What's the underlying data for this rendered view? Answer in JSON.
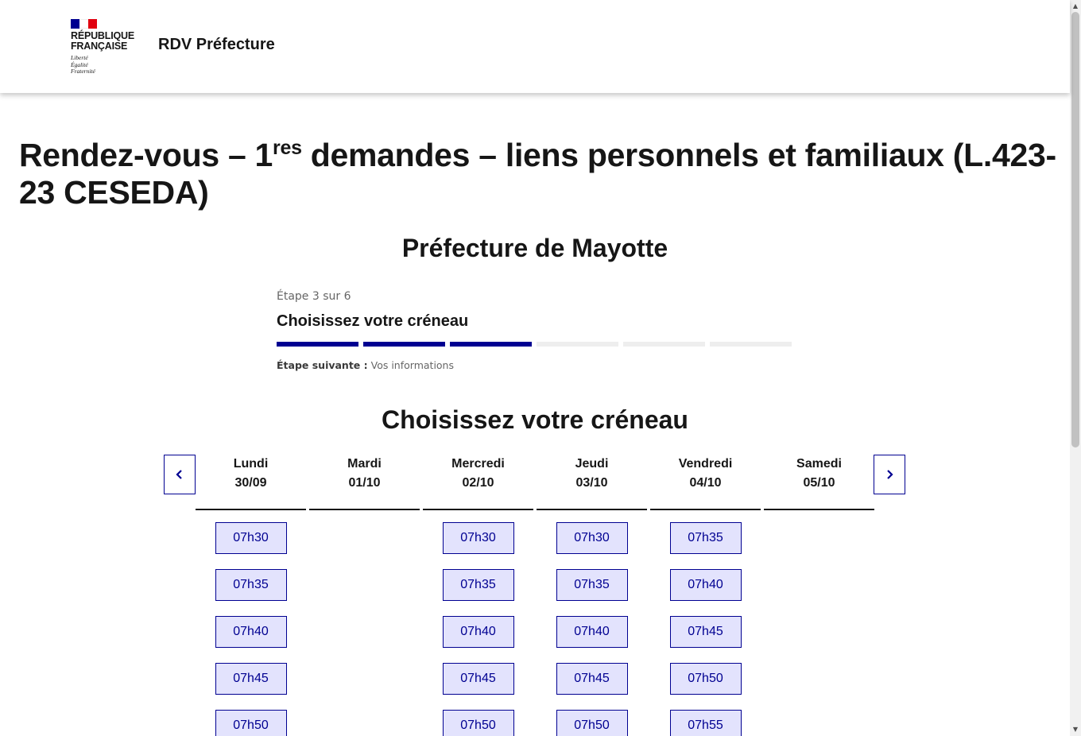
{
  "header": {
    "republic_line1": "RÉPUBLIQUE",
    "republic_line2": "FRANÇAISE",
    "motto_1": "Liberté",
    "motto_2": "Égalité",
    "motto_3": "Fraternité",
    "site_title": "RDV Préfecture"
  },
  "page": {
    "title_prefix": "Rendez-vous – 1",
    "title_sup": "res",
    "title_suffix": " demandes – liens personnels et familiaux (L.423-23 CESEDA)",
    "prefecture": "Préfecture de Mayotte",
    "slot_heading": "Choisissez votre créneau"
  },
  "stepper": {
    "count": "Étape 3 sur 6",
    "title": "Choisissez votre créneau",
    "current_step": 3,
    "total_steps": 6,
    "next_label": "Étape suivante :",
    "next_value": "Vos informations"
  },
  "calendar": {
    "prev_icon": "chevron-left-icon",
    "next_icon": "chevron-right-icon",
    "days": [
      {
        "name": "Lundi",
        "date": "30/09",
        "slots": [
          "07h30",
          "07h35",
          "07h40",
          "07h45",
          "07h50"
        ]
      },
      {
        "name": "Mardi",
        "date": "01/10",
        "slots": []
      },
      {
        "name": "Mercredi",
        "date": "02/10",
        "slots": [
          "07h30",
          "07h35",
          "07h40",
          "07h45",
          "07h50"
        ]
      },
      {
        "name": "Jeudi",
        "date": "03/10",
        "slots": [
          "07h30",
          "07h35",
          "07h40",
          "07h45",
          "07h50"
        ]
      },
      {
        "name": "Vendredi",
        "date": "04/10",
        "slots": [
          "07h35",
          "07h40",
          "07h45",
          "07h50",
          "07h55"
        ]
      },
      {
        "name": "Samedi",
        "date": "05/10",
        "slots": []
      }
    ]
  },
  "colors": {
    "primary": "#000091",
    "slot_bg": "#e3e3fd",
    "marianne_red": "#e1000f"
  }
}
